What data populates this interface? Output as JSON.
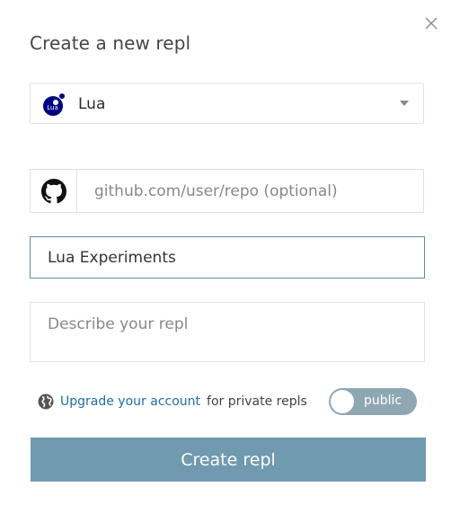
{
  "dialog": {
    "title": "Create a new repl"
  },
  "language": {
    "selected": "Lua",
    "logo_text": "Lua"
  },
  "github": {
    "placeholder": "github.com/user/repo (optional)",
    "value": ""
  },
  "repl_name": {
    "value": "Lua Experiments"
  },
  "description": {
    "placeholder": "Describe your repl",
    "value": ""
  },
  "privacy": {
    "upgrade_link": "Upgrade your account",
    "suffix_text": "for private repls",
    "toggle_label": "public"
  },
  "actions": {
    "create_label": "Create repl"
  },
  "colors": {
    "accent": "#6f9aaf",
    "link": "#1e6fa6",
    "lua_logo": "#000080"
  }
}
